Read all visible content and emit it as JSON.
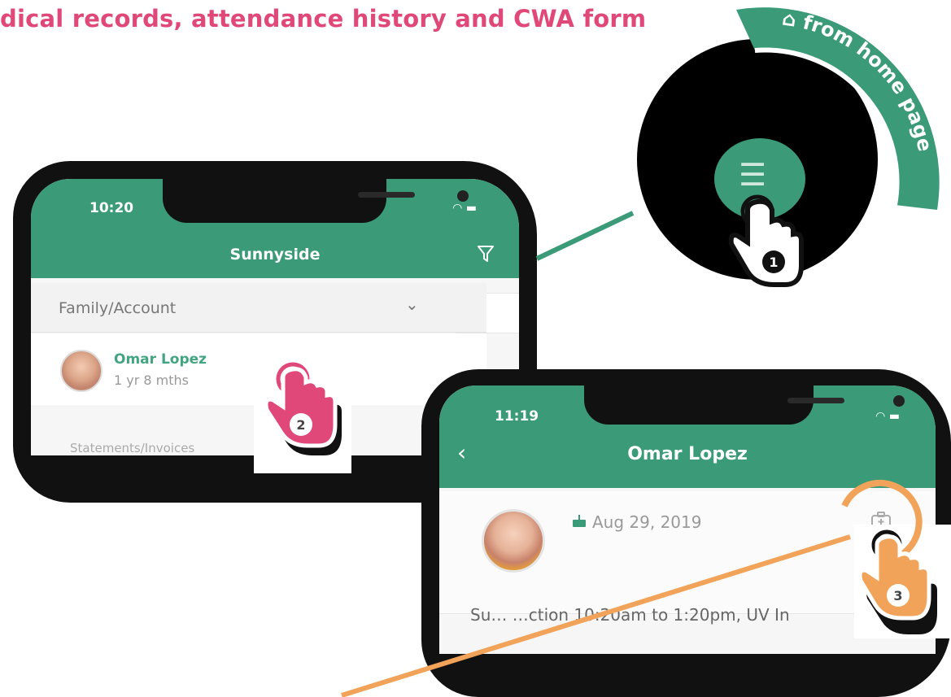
{
  "banner": {
    "title": "dical records, attendance history and CWA form"
  },
  "callout1": {
    "arc_label": "from home page",
    "step": "1"
  },
  "phone1": {
    "time": "10:20",
    "app_title": "Sunnyside",
    "dropdown_label": "Family/Account",
    "child_name": "Omar Lopez",
    "child_age": "1 yr 8 mths",
    "next_row": "Statements/Invoices",
    "step": "2"
  },
  "phone2": {
    "time": "11:19",
    "app_title": "Omar Lopez",
    "dob": "Aug 29, 2019",
    "info": "Su… …ction 10:20am to 1:20pm, UV In",
    "step": "3"
  },
  "colors": {
    "brand_green": "#3b9b78",
    "pink_accent": "#e0487a",
    "orange_accent": "#f2a35a"
  },
  "icons": {
    "home": "home-icon",
    "menu": "hamburger-menu-icon",
    "filter": "filter-icon",
    "back": "back-chevron-icon",
    "medical": "medical-kit-icon",
    "birthday": "birthday-cake-icon",
    "tap_hand": "tap-hand-icon"
  }
}
